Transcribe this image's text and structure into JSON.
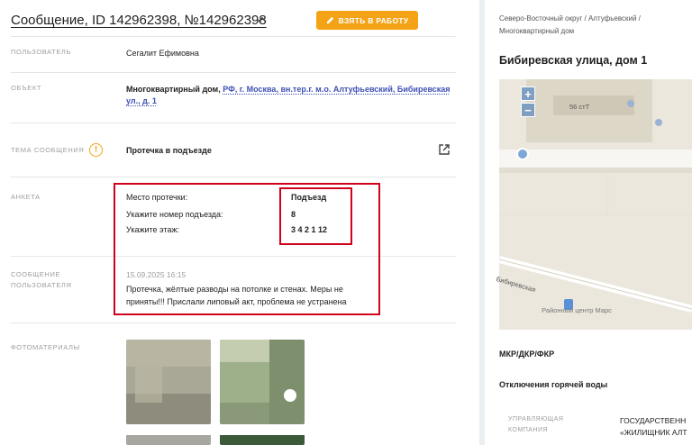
{
  "ticket": {
    "title": "Сообщение, ID 142962398, №142962398",
    "take_button": "ВЗЯТЬ В РАБОТУ"
  },
  "fields": {
    "user": {
      "label": "ПОЛЬЗОВАТЕЛЬ",
      "value": "Сегалит Ефимовна"
    },
    "object": {
      "label": "ОБЪЕКТ",
      "prefix": "Многоквартирный дом, ",
      "link": "РФ, г. Москва, вн.тер.г. м.о. Алтуфьевский, Бибиревская ул., д. 1"
    },
    "topic": {
      "label": "ТЕМА СООБЩЕНИЯ",
      "value": "Протечка в подъезде"
    },
    "survey": {
      "label": "АНКЕТА",
      "rows": [
        {
          "key": "Место протечки:",
          "value": "Подъезд"
        },
        {
          "key": "Укажите номер подъезда:",
          "value": "8"
        },
        {
          "key": "Укажите этаж:",
          "value": "3 4 2 1 12"
        }
      ]
    },
    "message": {
      "label_line1": "СООБЩЕНИЕ",
      "label_line2": "ПОЛЬЗОВАТЕЛЯ",
      "date": "15.09.2025 16:15",
      "text": "Протечка, жёлтые разводы на потолке и стенах. Меры не приняты!!! Прислали липовый акт, проблема не устранена"
    },
    "photos": {
      "label": "ФОТОМАТЕРИАЛЫ"
    }
  },
  "side": {
    "breadcrumb": "Северо-Восточный округ / Алтуфьевский / Многоквартирный дом",
    "address": "Бибиревская улица, дом 1",
    "map": {
      "zoom_in": "+",
      "zoom_out": "−",
      "street_label": "Бибиревская",
      "poi": "Районный центр Марс",
      "house_label": "56 стТ"
    },
    "section1": "МКР/ДКР/ФКР",
    "section2": "Отключения горячей воды",
    "mgmt_label_line1": "УПРАВЛЯЮЩАЯ",
    "mgmt_label_line2": "КОМПАНИЯ",
    "mgmt_value_line1": "ГОСУДАРСТВЕНН",
    "mgmt_value_line2": "«ЖИЛИЩНИК АЛТ"
  },
  "colors": {
    "accent": "#f5a316",
    "link": "#3f51b5",
    "highlight": "#d0021b"
  }
}
